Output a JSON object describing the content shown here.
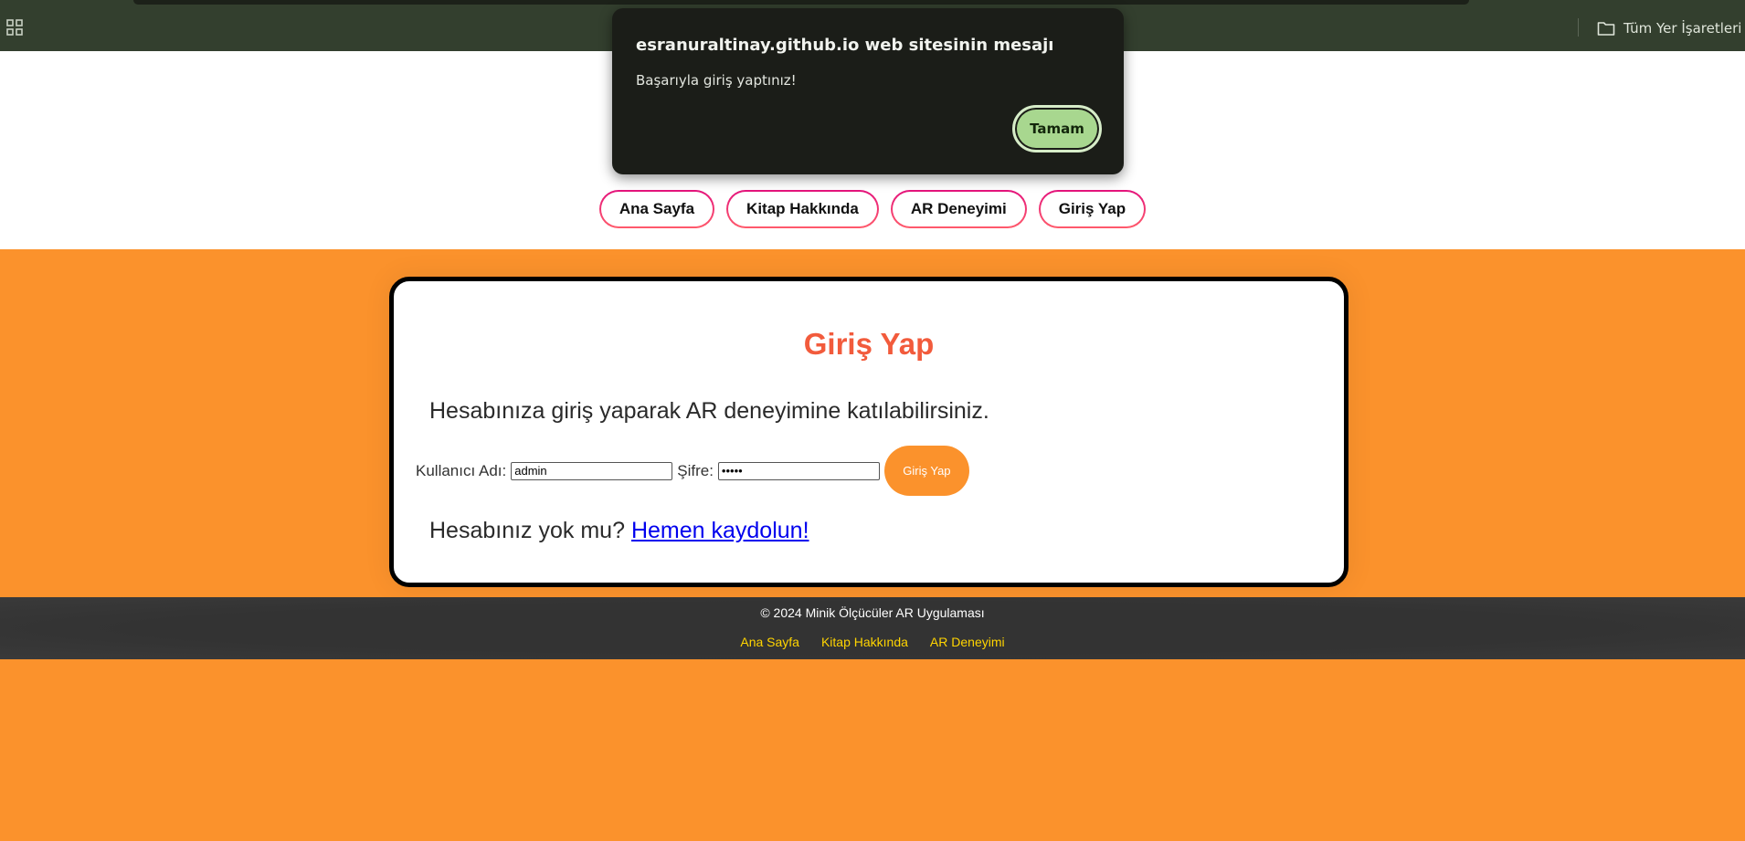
{
  "browser": {
    "all_bookmarks_label": "Tüm Yer İşaretleri"
  },
  "nav": {
    "items": [
      {
        "label": "Ana Sayfa"
      },
      {
        "label": "Kitap Hakkında"
      },
      {
        "label": "AR Deneyimi"
      },
      {
        "label": "Giriş Yap"
      }
    ]
  },
  "login": {
    "title": "Giriş Yap",
    "description": "Hesabınıza giriş yaparak AR deneyimine katılabilirsiniz.",
    "username_label": "Kullanıcı Adı:",
    "username_value": "admin",
    "password_label": "Şifre:",
    "password_value": "•••••",
    "submit_label": "Giriş Yap",
    "signup_prompt": "Hesabınız yok mu?",
    "signup_link": "Hemen kaydolun!"
  },
  "footer": {
    "copyright": "© 2024 Minik Ölçücüler AR Uygulaması",
    "links": [
      {
        "label": "Ana Sayfa"
      },
      {
        "label": "Kitap Hakkında"
      },
      {
        "label": "AR Deneyimi"
      }
    ]
  },
  "dialog": {
    "title": "esranuraltinay.github.io web sitesinin mesajı",
    "message": "Başarıyla giriş yaptınız!",
    "ok_label": "Tamam",
    "ok_color": "#a8d78f"
  },
  "colors": {
    "page_bg": "#fb922c",
    "title": "#f25b3c",
    "footer_link": "#ffd400",
    "footer_bg": "#333333"
  }
}
